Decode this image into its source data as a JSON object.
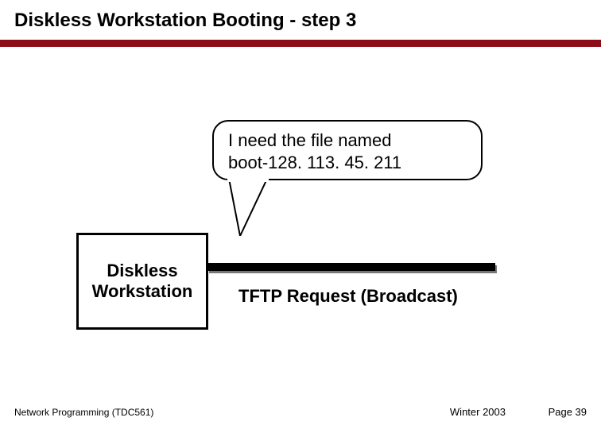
{
  "title": {
    "main": "Diskless Workstation Booting",
    "step": " - step 3"
  },
  "speech": {
    "line1": "I need the file named",
    "line2": " boot-128. 113. 45. 211"
  },
  "box_label": "Diskless Workstation",
  "caption": "TFTP Request (Broadcast)",
  "footer": {
    "left": "Network Programming (TDC561)",
    "term": "Winter  2003",
    "page": "Page 39"
  },
  "colors": {
    "accent": "#8b0b16"
  }
}
